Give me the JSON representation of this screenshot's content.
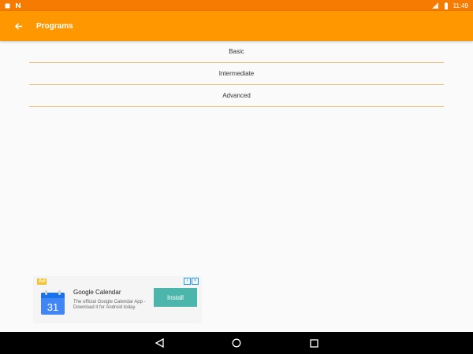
{
  "status_bar": {
    "time": "11:49"
  },
  "app_bar": {
    "title": "Programs",
    "back_icon": "arrow-back-icon"
  },
  "programs": [
    {
      "label": "Basic"
    },
    {
      "label": "Intermediate"
    },
    {
      "label": "Advanced"
    }
  ],
  "ad": {
    "badge": "Ad",
    "title": "Google Calendar",
    "description": "The official Google Calendar App - Download it for Android today.",
    "install_label": "Install",
    "icon_number": "31",
    "icon": "google-calendar-icon"
  },
  "nav_bar": {
    "back_icon": "nav-back-icon",
    "home_icon": "nav-home-icon",
    "recents_icon": "nav-recents-icon"
  },
  "colors": {
    "app_bar": "#ff9800",
    "status_bar": "#f57c00",
    "divider": "#f3c27e",
    "install_button": "#4db6ac"
  }
}
